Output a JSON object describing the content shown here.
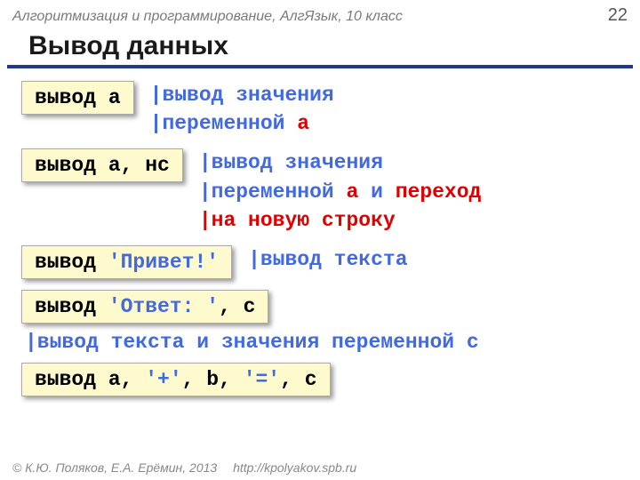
{
  "header": {
    "course": "Алгоритмизация и программирование, АлгЯзык, 10 класс",
    "page": "22"
  },
  "title": "Вывод данных",
  "rows": [
    {
      "code_kw": "вывод ",
      "code_rest": "a",
      "comment_pre": "|вывод значения\n|переменной ",
      "comment_red": "a",
      "comment_post": ""
    },
    {
      "code_kw": "вывод ",
      "code_rest": "a, нс",
      "comment_pre": "|вывод значения\n|переменной ",
      "comment_red": "a",
      "comment_mid": " и ",
      "comment_red2": "переход\n|на новую строку"
    }
  ],
  "row3": {
    "code_kw": "вывод ",
    "code_str": "'Привет!'",
    "comment": "|вывод текста"
  },
  "row4": {
    "code_kw": "вывод ",
    "code_str": "'Ответ: '",
    "code_rest": ", c"
  },
  "comment4": "|вывод текста и значения переменной c",
  "row5": {
    "code_kw": "вывод ",
    "p1": "a, ",
    "s1": "'+'",
    "p2": ", b, ",
    "s2": "'='",
    "p3": ", c"
  },
  "footer": {
    "copyright": "© К.Ю. Поляков, Е.А. Ерёмин, 2013",
    "url": "http://kpolyakov.spb.ru"
  }
}
